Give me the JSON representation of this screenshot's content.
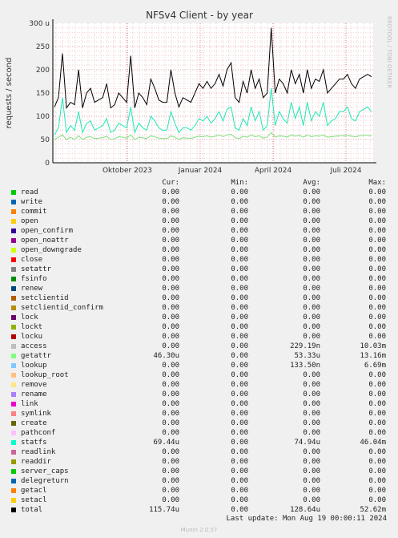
{
  "chart_data": {
    "type": "line",
    "title": "NFSv4 Client - by year",
    "ylabel": "requests / second",
    "ylim": [
      0,
      300
    ],
    "yticks": [
      "0",
      "50",
      "100",
      "150",
      "200",
      "250",
      "300 u"
    ],
    "xticks": [
      "Oktober 2023",
      "Januar 2024",
      "April 2024",
      "Juli 2024"
    ],
    "grid": true,
    "series": [
      {
        "name": "total",
        "color": "#000000",
        "values": [
          120,
          140,
          235,
          118,
          130,
          125,
          200,
          118,
          150,
          160,
          130,
          135,
          140,
          170,
          118,
          125,
          150,
          140,
          130,
          230,
          118,
          150,
          140,
          125,
          180,
          160,
          135,
          130,
          130,
          200,
          150,
          120,
          140,
          135,
          130,
          150,
          170,
          160,
          175,
          160,
          170,
          190,
          165,
          200,
          215,
          140,
          130,
          175,
          150,
          200,
          160,
          180,
          140,
          150,
          290,
          150,
          180,
          170,
          150,
          200,
          170,
          190,
          150,
          200,
          160,
          180,
          175,
          200,
          150,
          160,
          170,
          180,
          180,
          190,
          170,
          160,
          180,
          185,
          190,
          185
        ]
      },
      {
        "name": "statfs",
        "color": "#1de9b6",
        "values": [
          60,
          75,
          140,
          65,
          80,
          70,
          110,
          65,
          85,
          90,
          70,
          75,
          80,
          95,
          65,
          70,
          85,
          80,
          75,
          120,
          65,
          85,
          75,
          70,
          100,
          90,
          75,
          70,
          70,
          110,
          85,
          65,
          75,
          75,
          70,
          80,
          95,
          90,
          100,
          85,
          95,
          110,
          90,
          115,
          120,
          75,
          70,
          95,
          80,
          120,
          90,
          110,
          70,
          80,
          160,
          80,
          110,
          95,
          85,
          130,
          95,
          120,
          80,
          130,
          90,
          110,
          100,
          130,
          80,
          90,
          95,
          110,
          110,
          120,
          95,
          90,
          110,
          115,
          120,
          110
        ]
      },
      {
        "name": "getattr",
        "color": "#7ee07e",
        "values": [
          50,
          55,
          60,
          50,
          55,
          50,
          58,
          50,
          55,
          56,
          52,
          53,
          54,
          57,
          50,
          52,
          56,
          55,
          53,
          60,
          50,
          55,
          54,
          52,
          58,
          56,
          53,
          52,
          52,
          58,
          55,
          50,
          54,
          53,
          52,
          55,
          57,
          56,
          58,
          55,
          57,
          60,
          56,
          60,
          61,
          54,
          52,
          57,
          55,
          60,
          56,
          58,
          53,
          55,
          65,
          55,
          58,
          57,
          55,
          60,
          57,
          59,
          55,
          60,
          56,
          58,
          57,
          60,
          55,
          56,
          57,
          58,
          58,
          59,
          57,
          56,
          58,
          59,
          59,
          58
        ]
      }
    ]
  },
  "side_label": "RRDTOOL / TOBI OETIKER",
  "legend": {
    "headers": {
      "cur": "Cur:",
      "min": "Min:",
      "avg": "Avg:",
      "max": "Max:"
    },
    "rows": [
      {
        "name": "read",
        "color": "#00cc00",
        "cur": "0.00",
        "min": "0.00",
        "avg": "0.00",
        "max": "0.00"
      },
      {
        "name": "write",
        "color": "#0066b3",
        "cur": "0.00",
        "min": "0.00",
        "avg": "0.00",
        "max": "0.00"
      },
      {
        "name": "commit",
        "color": "#ff8000",
        "cur": "0.00",
        "min": "0.00",
        "avg": "0.00",
        "max": "0.00"
      },
      {
        "name": "open",
        "color": "#ffcc00",
        "cur": "0.00",
        "min": "0.00",
        "avg": "0.00",
        "max": "0.00"
      },
      {
        "name": "open_confirm",
        "color": "#330099",
        "cur": "0.00",
        "min": "0.00",
        "avg": "0.00",
        "max": "0.00"
      },
      {
        "name": "open_noattr",
        "color": "#990099",
        "cur": "0.00",
        "min": "0.00",
        "avg": "0.00",
        "max": "0.00"
      },
      {
        "name": "open_downgrade",
        "color": "#ccff00",
        "cur": "0.00",
        "min": "0.00",
        "avg": "0.00",
        "max": "0.00"
      },
      {
        "name": "close",
        "color": "#ff0000",
        "cur": "0.00",
        "min": "0.00",
        "avg": "0.00",
        "max": "0.00"
      },
      {
        "name": "setattr",
        "color": "#808080",
        "cur": "0.00",
        "min": "0.00",
        "avg": "0.00",
        "max": "0.00"
      },
      {
        "name": "fsinfo",
        "color": "#008f00",
        "cur": "0.00",
        "min": "0.00",
        "avg": "0.00",
        "max": "0.00"
      },
      {
        "name": "renew",
        "color": "#00487d",
        "cur": "0.00",
        "min": "0.00",
        "avg": "0.00",
        "max": "0.00"
      },
      {
        "name": "setclientid",
        "color": "#b35a00",
        "cur": "0.00",
        "min": "0.00",
        "avg": "0.00",
        "max": "0.00"
      },
      {
        "name": "setclientid_confirm",
        "color": "#b38f00",
        "cur": "0.00",
        "min": "0.00",
        "avg": "0.00",
        "max": "0.00"
      },
      {
        "name": "lock",
        "color": "#6b006b",
        "cur": "0.00",
        "min": "0.00",
        "avg": "0.00",
        "max": "0.00"
      },
      {
        "name": "lockt",
        "color": "#8fb300",
        "cur": "0.00",
        "min": "0.00",
        "avg": "0.00",
        "max": "0.00"
      },
      {
        "name": "locku",
        "color": "#b30000",
        "cur": "0.00",
        "min": "0.00",
        "avg": "0.00",
        "max": "0.00"
      },
      {
        "name": "access",
        "color": "#bebebe",
        "cur": "0.00",
        "min": "0.00",
        "avg": "229.19n",
        "max": "10.03m"
      },
      {
        "name": "getattr",
        "color": "#80ff80",
        "cur": "46.30u",
        "min": "0.00",
        "avg": "53.33u",
        "max": "13.16m"
      },
      {
        "name": "lookup",
        "color": "#80c9ff",
        "cur": "0.00",
        "min": "0.00",
        "avg": "133.50n",
        "max": "6.69m"
      },
      {
        "name": "lookup_root",
        "color": "#ffc080",
        "cur": "0.00",
        "min": "0.00",
        "avg": "0.00",
        "max": "0.00"
      },
      {
        "name": "remove",
        "color": "#ffe680",
        "cur": "0.00",
        "min": "0.00",
        "avg": "0.00",
        "max": "0.00"
      },
      {
        "name": "rename",
        "color": "#aa80ff",
        "cur": "0.00",
        "min": "0.00",
        "avg": "0.00",
        "max": "0.00"
      },
      {
        "name": "link",
        "color": "#ee00cc",
        "cur": "0.00",
        "min": "0.00",
        "avg": "0.00",
        "max": "0.00"
      },
      {
        "name": "symlink",
        "color": "#ff8080",
        "cur": "0.00",
        "min": "0.00",
        "avg": "0.00",
        "max": "0.00"
      },
      {
        "name": "create",
        "color": "#666600",
        "cur": "0.00",
        "min": "0.00",
        "avg": "0.00",
        "max": "0.00"
      },
      {
        "name": "pathconf",
        "color": "#ffbfff",
        "cur": "0.00",
        "min": "0.00",
        "avg": "0.00",
        "max": "0.00"
      },
      {
        "name": "statfs",
        "color": "#00ffcc",
        "cur": "69.44u",
        "min": "0.00",
        "avg": "74.94u",
        "max": "46.04m"
      },
      {
        "name": "readlink",
        "color": "#cc6699",
        "cur": "0.00",
        "min": "0.00",
        "avg": "0.00",
        "max": "0.00"
      },
      {
        "name": "readdir",
        "color": "#999900",
        "cur": "0.00",
        "min": "0.00",
        "avg": "0.00",
        "max": "0.00"
      },
      {
        "name": "server_caps",
        "color": "#00cc00",
        "cur": "0.00",
        "min": "0.00",
        "avg": "0.00",
        "max": "0.00"
      },
      {
        "name": "delegreturn",
        "color": "#0066b3",
        "cur": "0.00",
        "min": "0.00",
        "avg": "0.00",
        "max": "0.00"
      },
      {
        "name": "getacl",
        "color": "#ff8000",
        "cur": "0.00",
        "min": "0.00",
        "avg": "0.00",
        "max": "0.00"
      },
      {
        "name": "setacl",
        "color": "#ffcc00",
        "cur": "0.00",
        "min": "0.00",
        "avg": "0.00",
        "max": "0.00"
      },
      {
        "name": "total",
        "color": "#000000",
        "cur": "115.74u",
        "min": "0.00",
        "avg": "128.64u",
        "max": "52.62m"
      }
    ]
  },
  "last_update": "Last update: Mon Aug 19 00:00:11 2024",
  "footer": "Munin 2.0.57"
}
